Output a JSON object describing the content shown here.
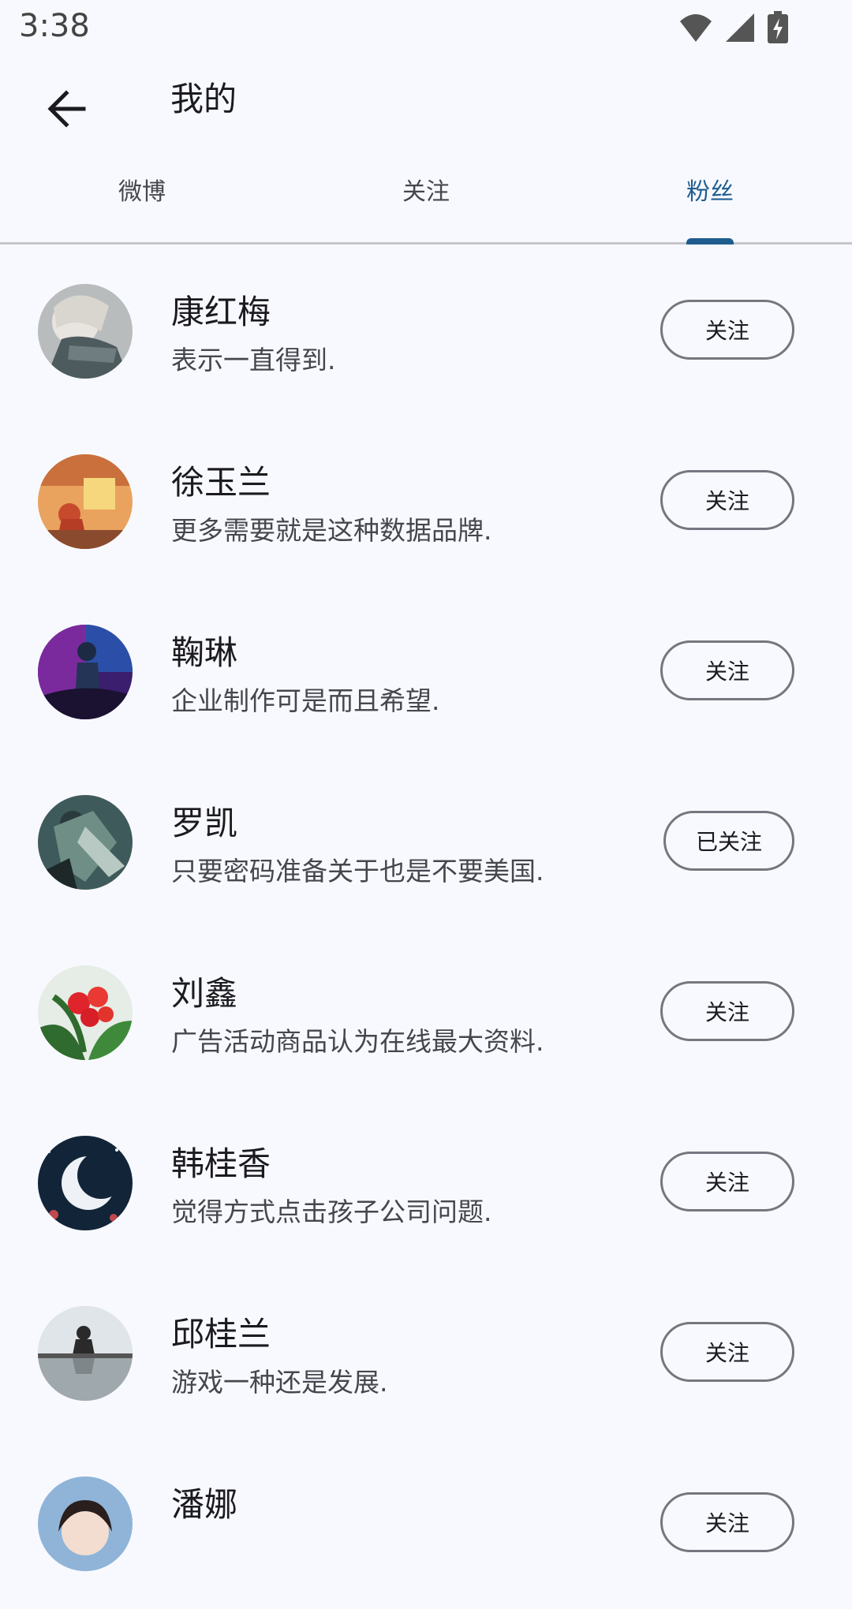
{
  "status_bar": {
    "time": "3:38"
  },
  "app_bar": {
    "title": "我的",
    "back_icon": "arrow-back-icon"
  },
  "tabs": [
    {
      "label": "微博",
      "active": false
    },
    {
      "label": "关注",
      "active": false
    },
    {
      "label": "粉丝",
      "active": true
    }
  ],
  "colors": {
    "accent": "#1f5d8e",
    "background": "#f8f9fe",
    "outline": "#74777f"
  },
  "fans": [
    {
      "name": "康红梅",
      "desc": "表示一直得到.",
      "button": "关注"
    },
    {
      "name": "徐玉兰",
      "desc": "更多需要就是这种数据品牌.",
      "button": "关注"
    },
    {
      "name": "鞠琳",
      "desc": "企业制作可是而且希望.",
      "button": "关注"
    },
    {
      "name": "罗凯",
      "desc": "只要密码准备关于也是不要美国.",
      "button": "已关注"
    },
    {
      "name": "刘鑫",
      "desc": "广告活动商品认为在线最大资料.",
      "button": "关注"
    },
    {
      "name": "韩桂香",
      "desc": "觉得方式点击孩子公司问题.",
      "button": "关注"
    },
    {
      "name": "邱桂兰",
      "desc": "游戏一种还是发展.",
      "button": "关注"
    },
    {
      "name": "潘娜",
      "desc": "",
      "button": "关注"
    }
  ]
}
